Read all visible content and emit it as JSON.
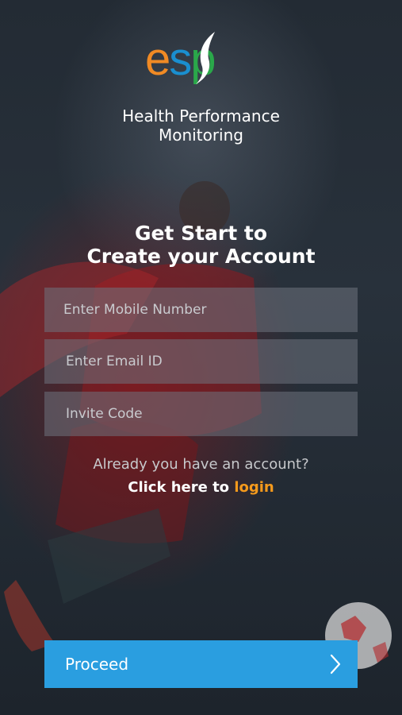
{
  "brand": {
    "logo_letters": [
      "e",
      "s",
      "p"
    ],
    "tagline_line1": "Health Performance",
    "tagline_line2": "Monitoring",
    "colors": {
      "e": "#f08a24",
      "s": "#1a8fd0",
      "p": "#2aa84a"
    }
  },
  "heading": {
    "line1": "Get Start to",
    "line2": "Create your Account"
  },
  "form": {
    "mobile_placeholder": "Enter Mobile Number",
    "email_placeholder": "Enter Email ID",
    "invite_placeholder": "Invite Code"
  },
  "account": {
    "already_text": "Already you have an account?",
    "click_prefix": "Click here to ",
    "login_link": "login"
  },
  "actions": {
    "proceed_label": "Proceed",
    "proceed_icon": "chevron-right-icon"
  },
  "theme": {
    "accent": "#2a9ee0",
    "link": "#f59a1c",
    "field_bg": "rgba(110,115,125,0.55)"
  }
}
